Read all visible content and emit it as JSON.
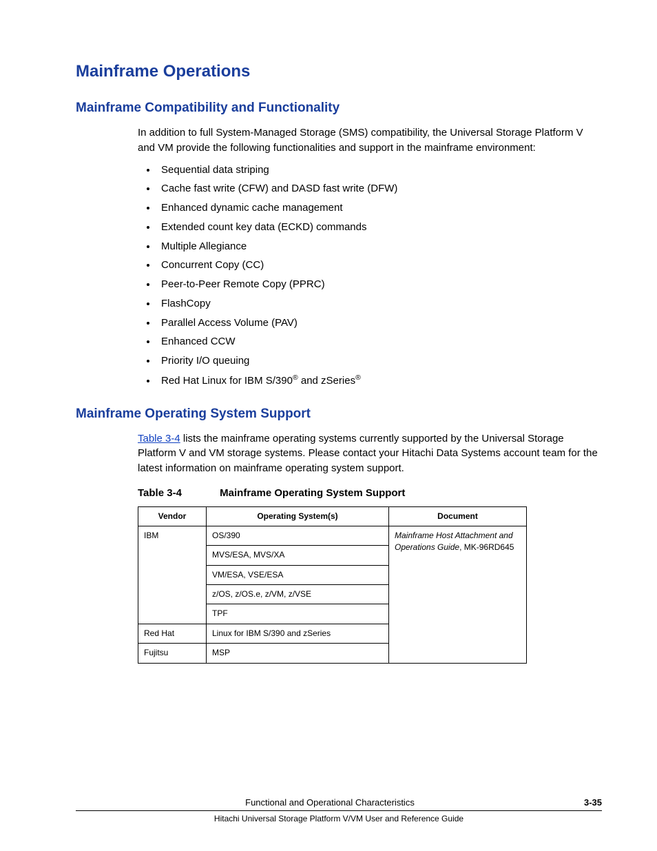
{
  "heading_main": "Mainframe Operations",
  "section1": {
    "title": "Mainframe Compatibility and Functionality",
    "intro": "In addition to full System-Managed Storage (SMS) compatibility, the Universal Storage Platform V and VM provide the following functionalities and support in the mainframe environment:",
    "bullets": [
      "Sequential data striping",
      "Cache fast write (CFW) and DASD fast write (DFW)",
      "Enhanced dynamic cache management",
      "Extended count key data (ECKD) commands",
      "Multiple Allegiance",
      "Concurrent Copy (CC)",
      "Peer-to-Peer Remote Copy (PPRC)",
      "FlashCopy",
      "Parallel Access Volume (PAV)",
      "Enhanced CCW",
      "Priority I/O queuing"
    ],
    "last_bullet_prefix": "Red Hat Linux for IBM S/390",
    "last_bullet_mid": " and zSeries",
    "reg_symbol": "®"
  },
  "section2": {
    "title": "Mainframe Operating System Support",
    "link_text": "Table 3-4",
    "para_after_link": " lists the mainframe operating systems currently supported by the Universal Storage Platform V and VM storage systems. Please contact your Hitachi Data Systems account team for the latest information on mainframe operating system support.",
    "table_caption_num": "Table 3-4",
    "table_caption_title": "Mainframe Operating System Support",
    "headers": {
      "c1": "Vendor",
      "c2": "Operating System(s)",
      "c3": "Document"
    },
    "rows": {
      "ibm_vendor": "IBM",
      "ibm_os": [
        "OS/390",
        "MVS/ESA, MVS/XA",
        "VM/ESA, VSE/ESA",
        "z/OS, z/OS.e, z/VM, z/VSE",
        "TPF"
      ],
      "redhat": {
        "vendor": "Red Hat",
        "os": "Linux for IBM S/390 and zSeries"
      },
      "fujitsu": {
        "vendor": "Fujitsu",
        "os": "MSP"
      },
      "doc_title": "Mainframe Host Attachment and Operations Guide",
      "doc_id": ", MK-96RD645"
    }
  },
  "footer": {
    "chapter": "Functional and Operational Characteristics",
    "pagenum": "3-35",
    "book": "Hitachi Universal Storage Platform V/VM User and Reference Guide"
  }
}
